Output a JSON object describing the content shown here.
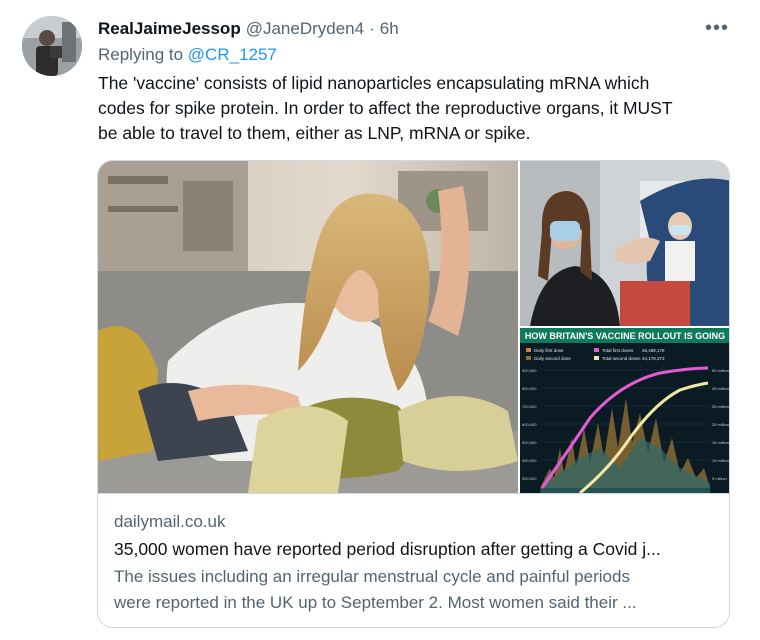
{
  "tweet": {
    "display_name": "RealJaimeJessop",
    "handle": "@JaneDryden4",
    "separator": "·",
    "time": "6h",
    "more_label": "•••",
    "reply_prefix": "Replying to",
    "reply_mention": "@CR_1257",
    "text_lines": [
      "The 'vaccine' consists of lipid nanoparticles encapsulating mRNA which",
      "codes for spike protein. In order to affect the reproductive organs, it MUST",
      "be able to travel to them, either as LNP, mRNA or spike."
    ]
  },
  "card": {
    "domain": "dailymail.co.uk",
    "title": "35,000 women have reported period disruption after getting a Covid j...",
    "description_lines": [
      "The issues including an irregular menstrual cycle and painful periods",
      "were reported in the UK up to September 2. Most women said their ..."
    ],
    "chart": {
      "title": "HOW BRITAIN'S VACCINE ROLLOUT IS GOING",
      "legend": [
        "Daily first dose",
        "Total first doses",
        "Daily second dose",
        "Total second doses"
      ],
      "legend_values": [
        "48,488,178",
        "44,178,373"
      ],
      "colors": {
        "header_bg": "#0f7a5b",
        "bg": "#0b1b24",
        "first": "#e45bd6",
        "second": "#f2e6a8",
        "daily": "#c9853a"
      }
    }
  }
}
